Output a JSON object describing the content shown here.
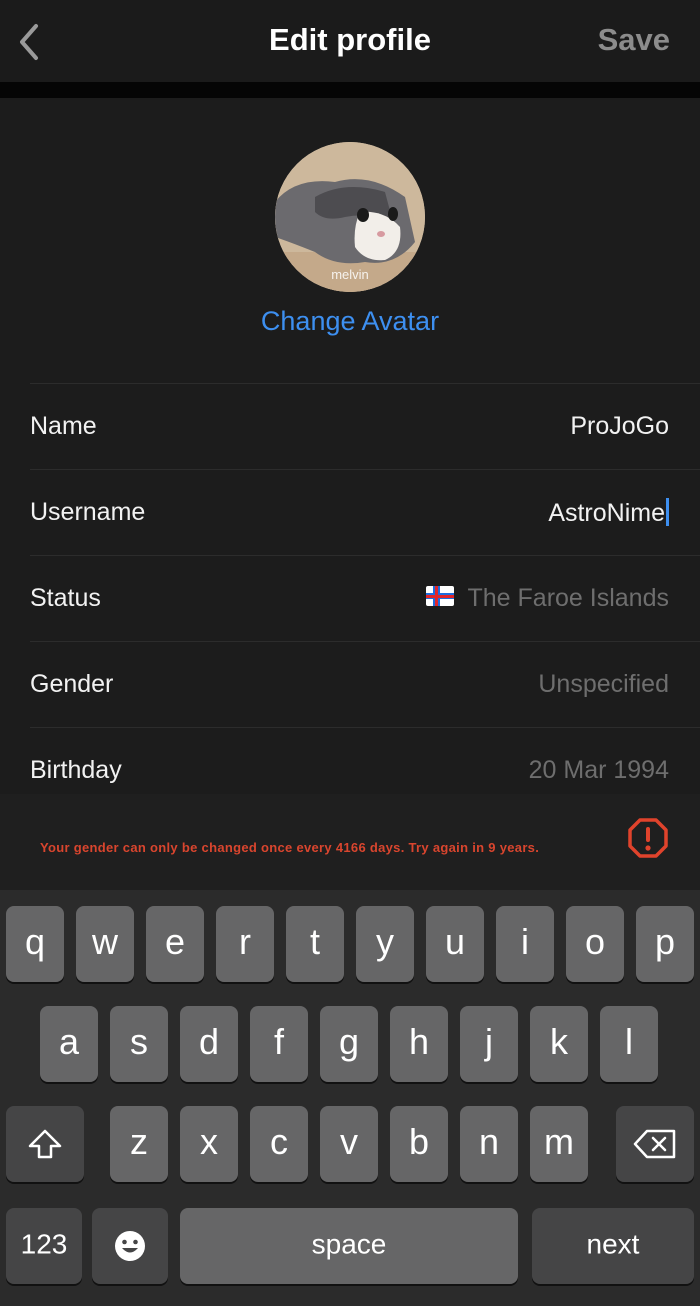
{
  "header": {
    "title": "Edit profile",
    "save_label": "Save"
  },
  "avatar": {
    "watermark": "melvin",
    "change_label": "Change Avatar"
  },
  "fields": [
    {
      "label": "Name",
      "value": "ProJoGo"
    },
    {
      "label": "Username",
      "value": "AstroNime"
    },
    {
      "label": "Status",
      "value": "The Faroe Islands",
      "flag": "faroe-islands-flag"
    },
    {
      "label": "Gender",
      "value": "Unspecified"
    },
    {
      "label": "Birthday",
      "value": "20 Mar 1994"
    }
  ],
  "toast": {
    "message": "Your gender can only be changed once every 4166 days. Try again in 9 years.",
    "icon": "warning-octagon-icon",
    "color": "#d9452e"
  },
  "keyboard": {
    "row1": [
      "q",
      "w",
      "e",
      "r",
      "t",
      "y",
      "u",
      "i",
      "o",
      "p"
    ],
    "row2": [
      "a",
      "s",
      "d",
      "f",
      "g",
      "h",
      "j",
      "k",
      "l"
    ],
    "row3": [
      "z",
      "x",
      "c",
      "v",
      "b",
      "n",
      "m"
    ],
    "numbers_label": "123",
    "space_label": "space",
    "return_label": "next"
  },
  "colors": {
    "accent": "#3d8ff0",
    "background": "#1c1c1c"
  }
}
